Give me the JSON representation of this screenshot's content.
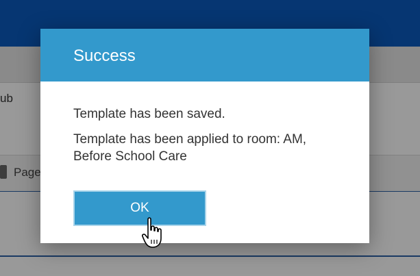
{
  "background": {
    "row_text": "ub",
    "toolbar_label": "Page"
  },
  "dialog": {
    "title": "Success",
    "message_saved": "Template has been saved.",
    "message_applied": "Template has been applied to room: AM, Before School Care",
    "ok_label": "OK"
  },
  "colors": {
    "header_blue": "#3399cc",
    "topbar_blue": "#0a5bbf"
  },
  "icons": {
    "cursor": "hand-pointer-icon",
    "page": "page-icon"
  }
}
